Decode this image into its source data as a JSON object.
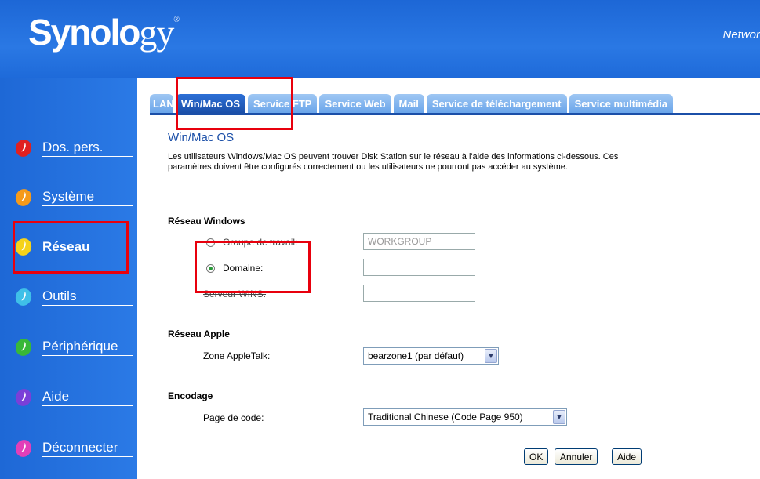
{
  "header": {
    "logo_main": "Synolo",
    "logo_tail": "gy",
    "logo_mark": "®",
    "right_text": "Networ"
  },
  "sidebar": {
    "items": [
      {
        "label": "Dos. pers.",
        "color": "#e02020"
      },
      {
        "label": "Système",
        "color": "#f59a1a"
      },
      {
        "label": "Réseau",
        "color": "#f5d21a"
      },
      {
        "label": "Outils",
        "color": "#3fc0e8"
      },
      {
        "label": "Périphérique",
        "color": "#38b838"
      },
      {
        "label": "Aide",
        "color": "#7a3fd8"
      },
      {
        "label": "Déconnecter",
        "color": "#e23fb8"
      }
    ],
    "active": "Réseau"
  },
  "tabs": [
    {
      "label": "LAN"
    },
    {
      "label": "Win/Mac OS"
    },
    {
      "label": "Service FTP"
    },
    {
      "label": "Service Web"
    },
    {
      "label": "Mail"
    },
    {
      "label": "Service de téléchargement"
    },
    {
      "label": "Service multimédia"
    }
  ],
  "active_tab": "Win/Mac OS",
  "page": {
    "title": "Win/Mac OS",
    "description": "Les utilisateurs Windows/Mac OS peuvent trouver Disk Station sur le réseau à l'aide des informations ci-dessous. Ces paramètres doivent être configurés correctement ou les utilisateurs ne pourront pas accéder au système."
  },
  "windows": {
    "heading": "Réseau Windows",
    "workgroup_label": "Groupe de travail:",
    "workgroup_placeholder": "WORKGROUP",
    "domain_label": "Domaine:",
    "domain_value": "",
    "wins_label": "Serveur WINS:",
    "wins_value": ""
  },
  "apple": {
    "heading": "Réseau Apple",
    "zone_label": "Zone AppleTalk:",
    "zone_value": "bearzone1 (par défaut)"
  },
  "encoding": {
    "heading": "Encodage",
    "codepage_label": "Page de code:",
    "codepage_value": "Traditional Chinese (Code Page 950)"
  },
  "buttons": {
    "ok": "OK",
    "cancel": "Annuler",
    "help": "Aide"
  },
  "colors": {
    "accent": "#1b4fa8",
    "header_bg": "#1f6fd8",
    "highlight": "#e8000d"
  }
}
